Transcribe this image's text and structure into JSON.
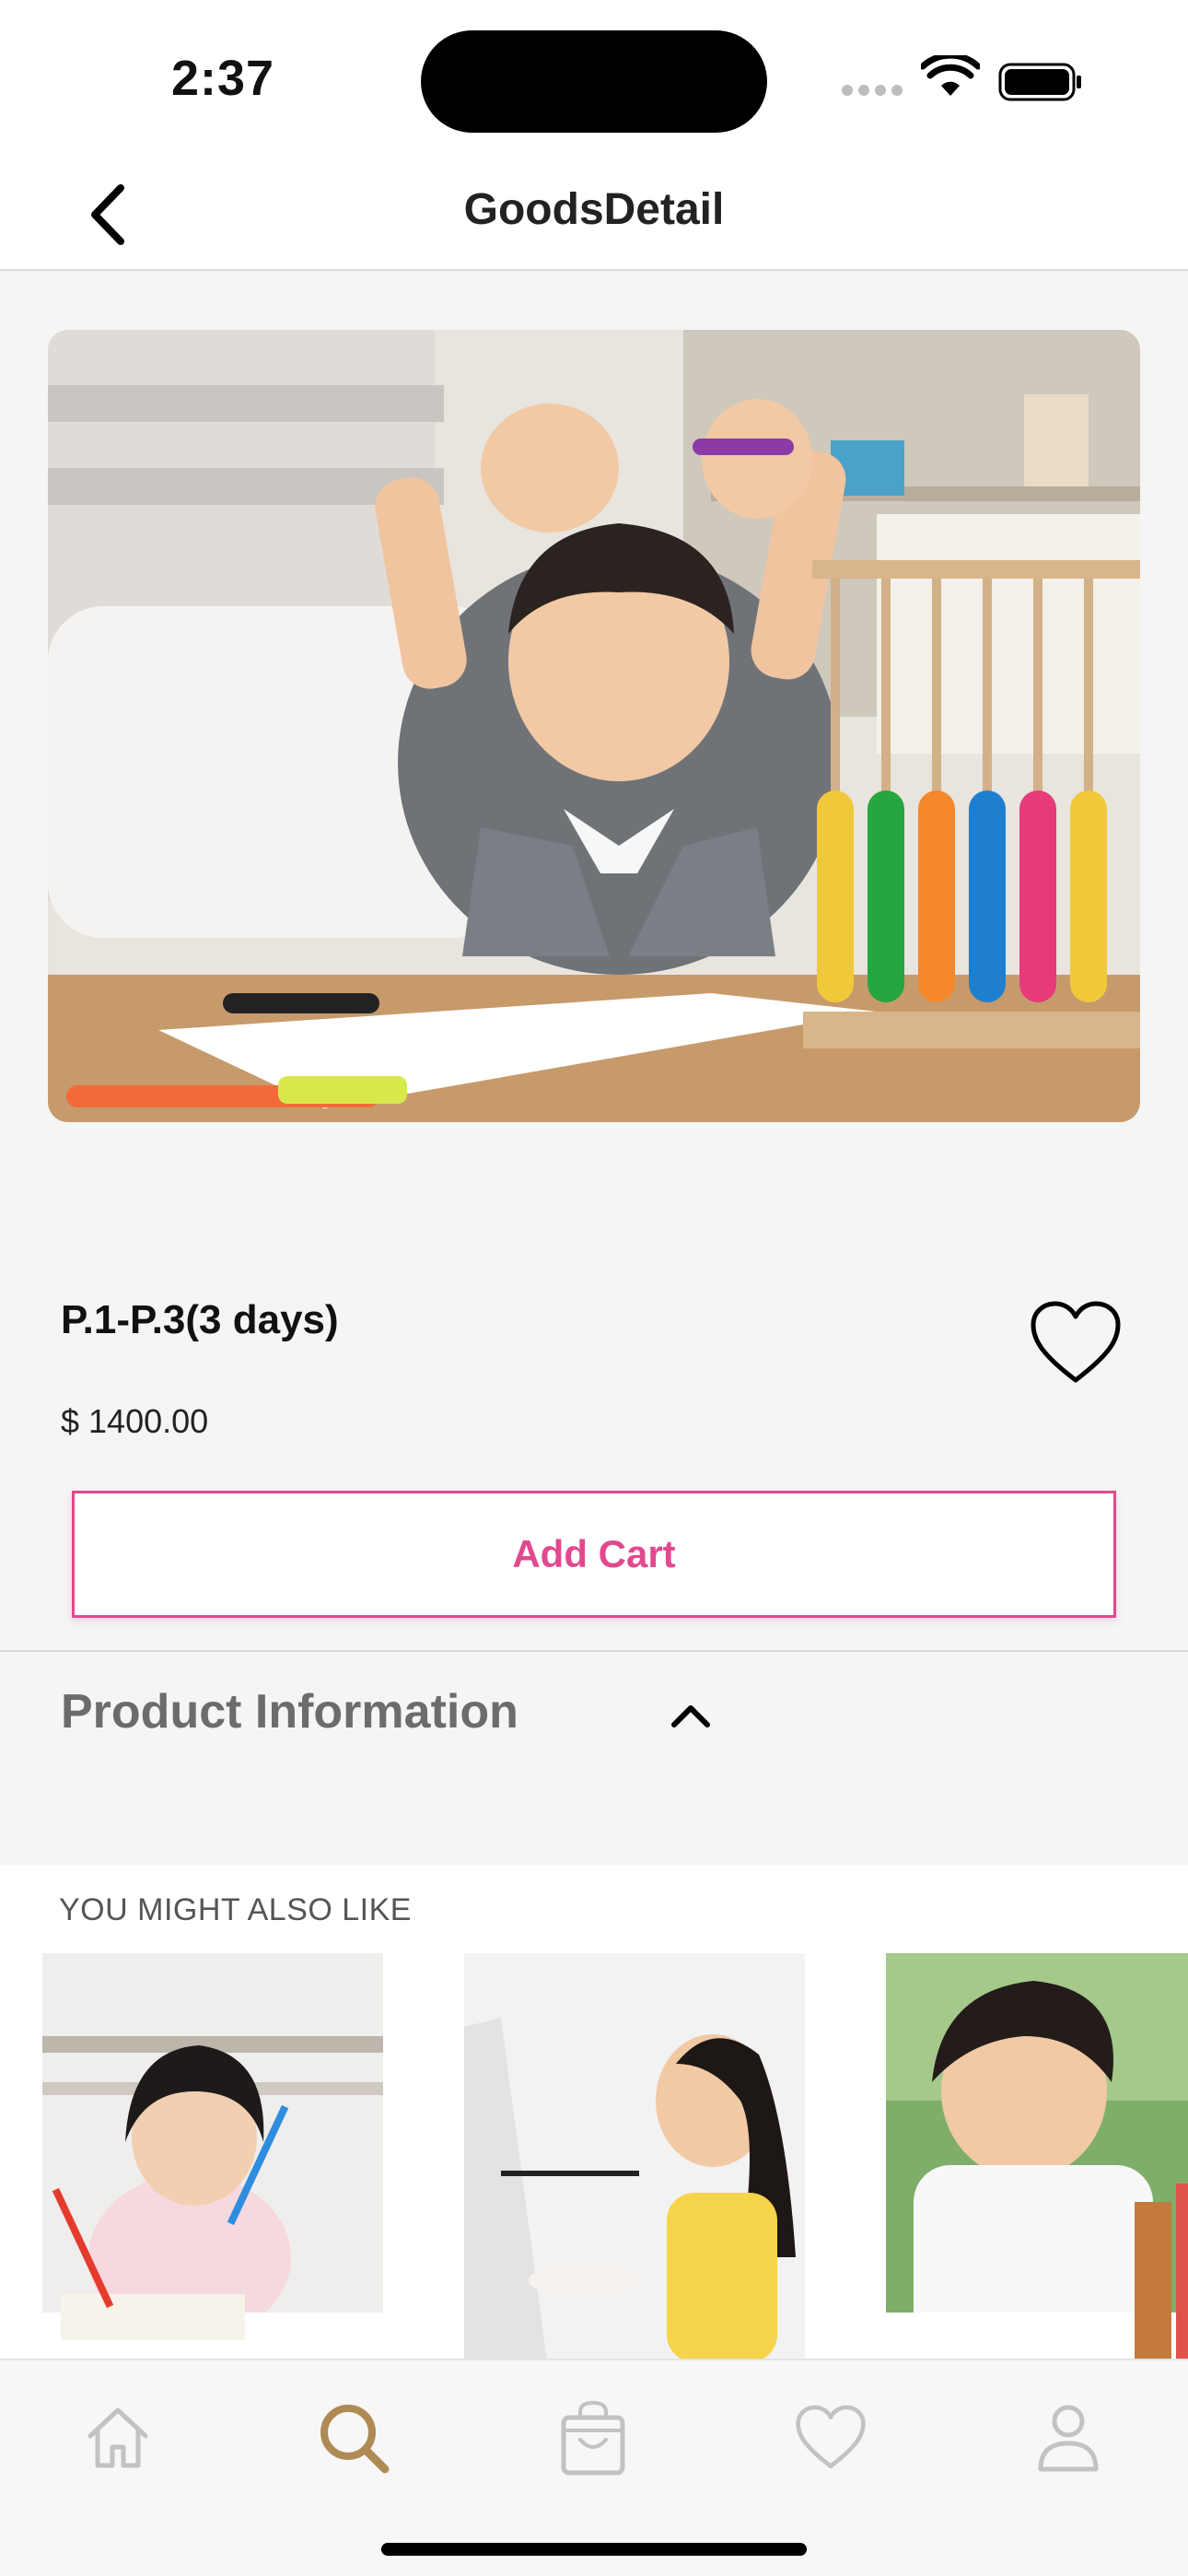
{
  "status_bar": {
    "time": "2:37",
    "icons": [
      "cellular-signal-icon",
      "wifi-icon",
      "battery-icon"
    ]
  },
  "nav": {
    "title": "GoodsDetail",
    "back_icon": "chevron-left-icon"
  },
  "product": {
    "name": "P.1-P.3(3 days)",
    "price": "$ 1400.00",
    "favorite_icon": "heart-outline-icon",
    "add_cart_label": "Add Cart",
    "image": "photo of a smiling boy with raised hands at a table with crayons and an abacus"
  },
  "product_info": {
    "title": "Product Information",
    "toggle_icon": "chevron-up-icon"
  },
  "recommendations": {
    "label": "YOU MIGHT ALSO LIKE",
    "items": [
      {
        "image": "photo of a little girl drawing with colored pencils"
      },
      {
        "image": "photo of a girl painting at an easel"
      },
      {
        "image": "photo of a boy drawing at a table"
      }
    ]
  },
  "tab_bar": {
    "tabs": [
      {
        "name": "home",
        "icon": "home-icon",
        "active": false
      },
      {
        "name": "search",
        "icon": "search-icon",
        "active": true
      },
      {
        "name": "cart",
        "icon": "shopping-bag-icon",
        "active": false
      },
      {
        "name": "favorites",
        "icon": "heart-icon",
        "active": false
      },
      {
        "name": "profile",
        "icon": "person-icon",
        "active": false
      }
    ]
  },
  "colors": {
    "accent": "#e1498e",
    "active_tab": "#b08a55",
    "inactive_tab": "#c2c2c2",
    "background": "#f5f5f5"
  }
}
